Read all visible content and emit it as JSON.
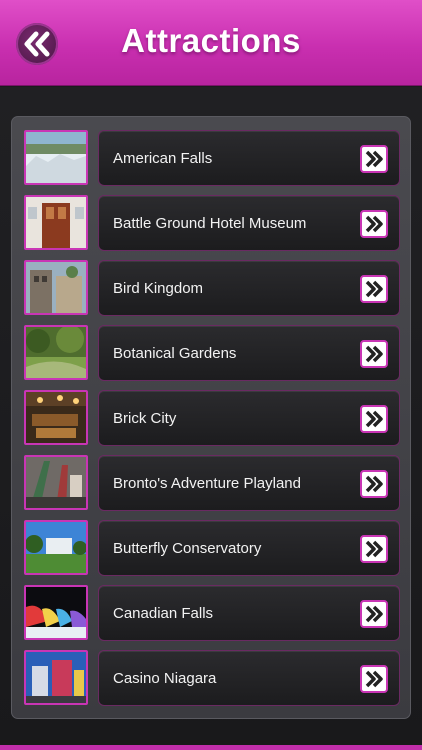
{
  "header": {
    "title": "Attractions",
    "back_icon": "double-chevron-left-icon",
    "accent_color": "#c92fb0"
  },
  "attractions": [
    {
      "label": "American Falls"
    },
    {
      "label": "Battle Ground Hotel Museum"
    },
    {
      "label": "Bird Kingdom"
    },
    {
      "label": "Botanical Gardens"
    },
    {
      "label": "Brick City"
    },
    {
      "label": "Bronto's Adventure Playland"
    },
    {
      "label": "Butterfly Conservatory"
    },
    {
      "label": "Canadian Falls"
    },
    {
      "label": "Casino Niagara"
    }
  ],
  "row_action_icon": "double-chevron-right-icon"
}
